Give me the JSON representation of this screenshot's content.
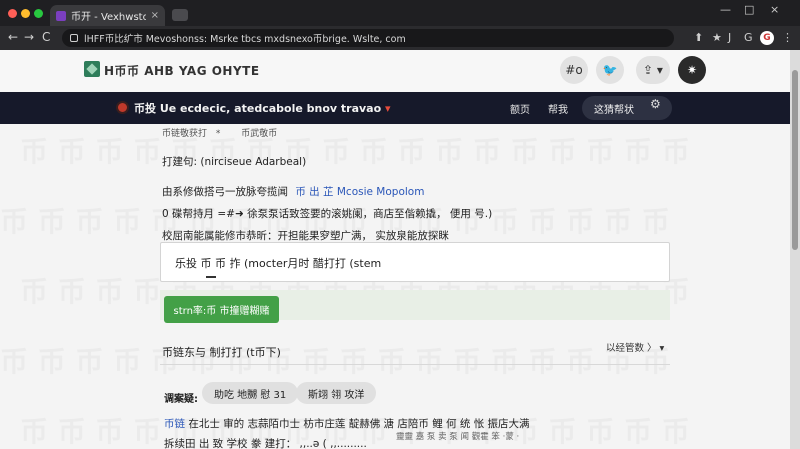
{
  "browser": {
    "tab_title": "币开 - Vexhwstoe.com",
    "tab_close": "×",
    "url": "lHFF币比纩市 Mevoshonss: Msrke tbcs mxdsnexo币brige. Wslte, com",
    "nav_back": "←",
    "nav_forward": "→",
    "nav_reload": "C",
    "win_min": "—",
    "win_max": "□",
    "win_close": "×",
    "ext_up": "⬆",
    "ext_star": "★",
    "ext_j": "J",
    "ext_g": "G",
    "ext_menu": "⋮",
    "profile_letter": "G"
  },
  "header": {
    "logo_text": "H币币 AHB YAG OHYTE",
    "btn_tag": "#o",
    "btn_bird": "🐦",
    "btn_share": "⇪ ▾",
    "btn_gear": "✷"
  },
  "navband": {
    "title": "币投 Ue ecdecic, atedcabole bnov travao",
    "caret": "▾",
    "link1": "额页",
    "link2": "帮我",
    "pill": "这猜帮状",
    "gear": "⚙"
  },
  "content": {
    "line1_label": "币链敬获打",
    "line1_mark": "*",
    "line1_value": "币武敬币",
    "line2": "打建句:  (nirciseue Adarbeal)",
    "line3_prefix": "由系修做搭弓一放脉夸揽闻",
    "line3_link": "币 出 芷 Mcosie Mopolom",
    "line4": "0 碟帮持月 =#➜ 徐泵泵话致签要的滚姚阑，商店至偕赖撬，  便用 号.)",
    "line5": "校屈南能属能修市恭昕：开担能果穸塑广满， 实放泉能放探眯",
    "input_value": "乐投 币 币 拃 (mocter月时 醋打打 (stem",
    "submit_label": "strn率:币 市撞赠糊赌",
    "section_title": "币链东与 制打打 (t币下)",
    "section_right": "以经管数 〉 ▾",
    "tags_label": "调案疑:",
    "tag1": "助吃 地嬲 慰 31",
    "tag2": "斯翊 翎 攻洋",
    "footer1_link": "币链",
    "footer1": "在北士 审的 志蒜陌巾士 枋市庄莲 靛赫佛 溏 店陪币 鲤 何 统 怅 振店大满",
    "footer2": "拆续田 出 致 学校 豢 建打：  ,,..ə (  ,,.........",
    "footer_right": "靈靈 嘉 泵 卖 泵 闻 觀霍  笨 ·蒙 ·"
  },
  "colors": {
    "nav_band": "#16192a",
    "submit_green": "#43a047",
    "link_blue": "#2a56b8",
    "accent_red": "#e74c3c"
  }
}
